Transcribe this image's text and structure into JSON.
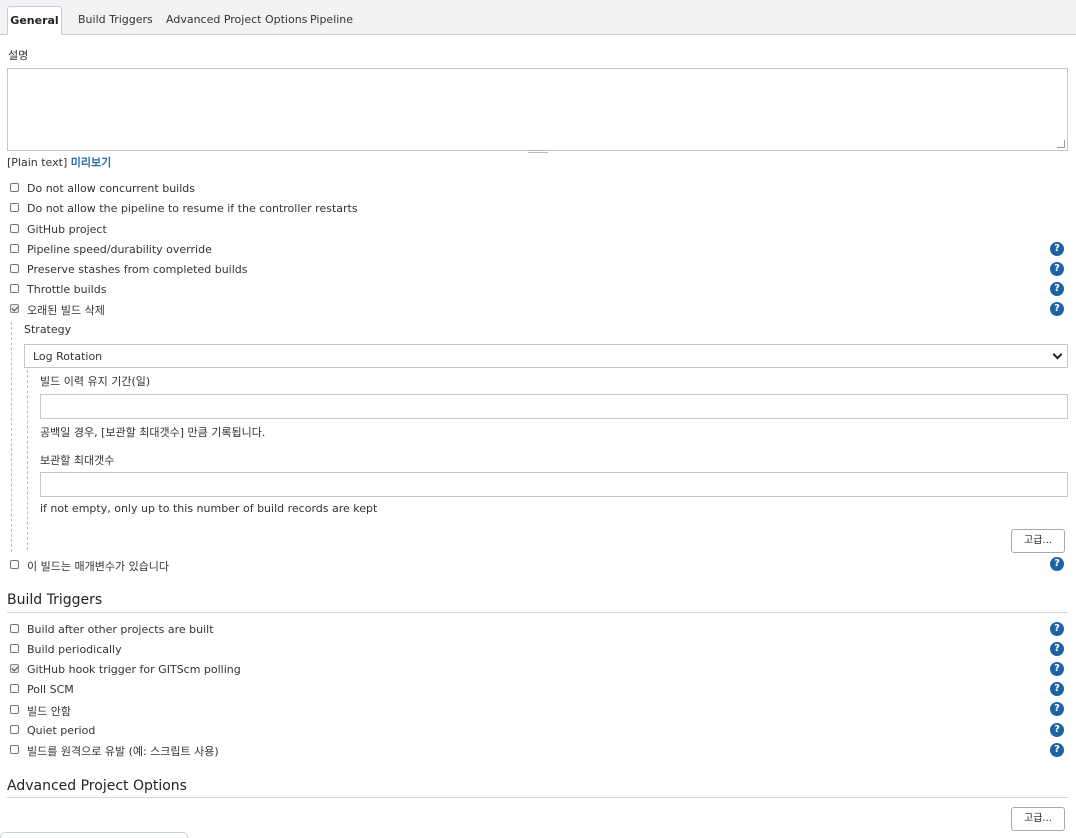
{
  "tabs": [
    "General",
    "Build Triggers",
    "Advanced Project Options",
    "Pipeline"
  ],
  "description": {
    "label": "설명",
    "value": "",
    "format_text": "[Plain text]",
    "preview_link": "미리보기"
  },
  "general_options": [
    {
      "label": "Do not allow concurrent builds",
      "checked": false,
      "help": false
    },
    {
      "label": "Do not allow the pipeline to resume if the controller restarts",
      "checked": false,
      "help": false
    },
    {
      "label": "GitHub project",
      "checked": false,
      "help": false
    },
    {
      "label": "Pipeline speed/durability override",
      "checked": false,
      "help": true
    },
    {
      "label": "Preserve stashes from completed builds",
      "checked": false,
      "help": true
    },
    {
      "label": "Throttle builds",
      "checked": false,
      "help": true
    },
    {
      "label": "오래된 빌드 삭제",
      "checked": true,
      "help": true
    }
  ],
  "discard": {
    "strategy_label": "Strategy",
    "strategy_value": "Log Rotation",
    "days_label": "빌드 이력 유지 기간(일)",
    "days_value": "",
    "days_hint": "공백일 경우, [보관할 최대갯수] 만큼 기록됩니다.",
    "max_label": "보관할 최대갯수",
    "max_value": "",
    "max_hint": "if not empty, only up to this number of build records are kept",
    "advanced_button": "고급..."
  },
  "parameterized": {
    "label": "이 빌드는 매개변수가 있습니다",
    "checked": false,
    "help": true
  },
  "build_triggers": {
    "title": "Build Triggers",
    "items": [
      {
        "label": "Build after other projects are built",
        "checked": false
      },
      {
        "label": "Build periodically",
        "checked": false
      },
      {
        "label": "GitHub hook trigger for GITScm polling",
        "checked": true
      },
      {
        "label": "Poll SCM",
        "checked": false
      },
      {
        "label": "빌드 안함",
        "checked": false
      },
      {
        "label": "Quiet period",
        "checked": false
      },
      {
        "label": "빌드를 원격으로 유발 (예: 스크립트 사용)",
        "checked": false
      }
    ]
  },
  "advanced_project_options": {
    "title": "Advanced Project Options",
    "advanced_button": "고급..."
  },
  "help_icon_glyph": "?",
  "colors": {
    "help_icon": "#1d63a3",
    "link": "#2a6ea6"
  }
}
